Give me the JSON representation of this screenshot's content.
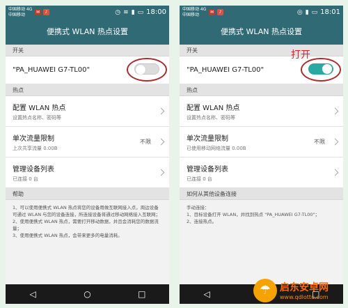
{
  "left": {
    "status": {
      "carrier": "中国移动 4G\n中国移动",
      "time": "18:00"
    },
    "title": "便携式 WLAN 热点设置",
    "switch_header": "开关",
    "ssid": "\"PA_HUAWEI G7-TL00\"",
    "toggle_state": "off",
    "hotspot_header": "热点",
    "config_title": "配置 WLAN 热点",
    "config_sub": "设置热点名称、密码等",
    "limit_title": "单次流量限制",
    "limit_sub": "上次共享流量 0.00B",
    "limit_value": "不限",
    "devices_title": "管理设备列表",
    "devices_sub": "已连接 0 台",
    "help_header": "帮助",
    "help_lines": [
      "1、可以使用便携式 WLAN 热点将您的设备用做互联网接入点，周边设备可通过 WLAN 与您的设备连接，所连接设备将通过移动网络接入互联网；",
      "2、使用便携式 WLAN 热点，需要打开移动数据，并且会消耗您的数据流量；",
      "3、使用便携式 WLAN 热点，会带来更多的电量消耗。"
    ]
  },
  "right": {
    "status": {
      "carrier": "中国移动 4G\n中国移动",
      "time": "18:01"
    },
    "title": "便携式 WLAN 热点设置",
    "switch_header": "开关",
    "ssid": "\"PA_HUAWEI G7-TL00\"",
    "toggle_state": "on",
    "annotation": "打开",
    "hotspot_header": "热点",
    "config_title": "配置 WLAN 热点",
    "config_sub": "设置热点名称、密码等",
    "limit_title": "单次流量限制",
    "limit_sub": "已使用移动网络流量 0.00B",
    "limit_value": "不限",
    "devices_title": "管理设备列表",
    "devices_sub": "已连接 0 台",
    "connect_header": "如何从其他设备连接",
    "connect_lines": [
      "手动连接：",
      "1、目标设备打开 WLAN，并找到热点 \"PA_HUAWEI G7-TL00\"；",
      "2、连接热点。"
    ]
  },
  "watermark": {
    "title": "启东安卓网",
    "url": "www.qdlottu.com"
  },
  "colors": {
    "bar": "#2f6a75",
    "toggle_on": "#28a9a2",
    "circle": "#b12a2a",
    "annotation": "#dd2222"
  }
}
